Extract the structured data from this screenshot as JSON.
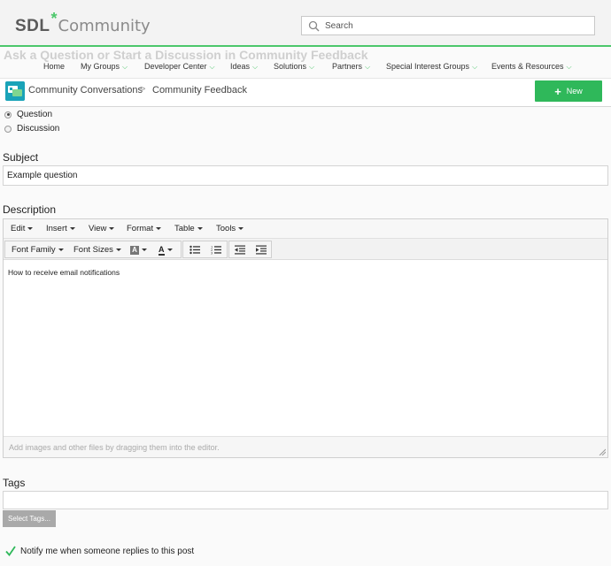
{
  "header": {
    "logo_sdl": "SDL",
    "logo_star": "*",
    "logo_community": "Community",
    "search_placeholder": "Search",
    "ghost_title": "Ask a Question or Start a Discussion in Community Feedback"
  },
  "nav": {
    "items": [
      {
        "label": "Home",
        "chevron": false
      },
      {
        "label": "My Groups",
        "chevron": true
      },
      {
        "label": "Developer Center",
        "chevron": true
      },
      {
        "label": "Ideas",
        "chevron": true
      },
      {
        "label": "Solutions",
        "chevron": true
      },
      {
        "label": "Partners",
        "chevron": true
      },
      {
        "label": "Special Interest Groups",
        "chevron": true
      },
      {
        "label": "Events & Resources",
        "chevron": true
      }
    ],
    "chevron_glyph": "⌵"
  },
  "breadcrumb": {
    "group": "Community Conversations",
    "separator": ">",
    "page": "Community Feedback",
    "new_button": "New",
    "new_plus": "+"
  },
  "post_type": {
    "options": [
      {
        "label": "Question",
        "checked": true
      },
      {
        "label": "Discussion",
        "checked": false
      }
    ]
  },
  "subject": {
    "label": "Subject",
    "value": "Example question"
  },
  "description": {
    "label": "Description",
    "menus": [
      "Edit",
      "Insert",
      "View",
      "Format",
      "Table",
      "Tools"
    ],
    "toolbar": {
      "font_family": "Font Family",
      "font_sizes": "Font Sizes",
      "bg_color_letter": "A",
      "text_color_letter": "A"
    },
    "content": "How to receive email notifications",
    "status_hint": "Add images and other files by dragging them into the editor."
  },
  "tags": {
    "label": "Tags",
    "value": "",
    "select_button": "Select Tags..."
  },
  "notify": {
    "label": "Notify me when someone replies to this post",
    "checked": true
  },
  "colors": {
    "accent_green": "#4cc76b",
    "new_button": "#2fb85a",
    "group_icon": "#1aa3b8"
  }
}
